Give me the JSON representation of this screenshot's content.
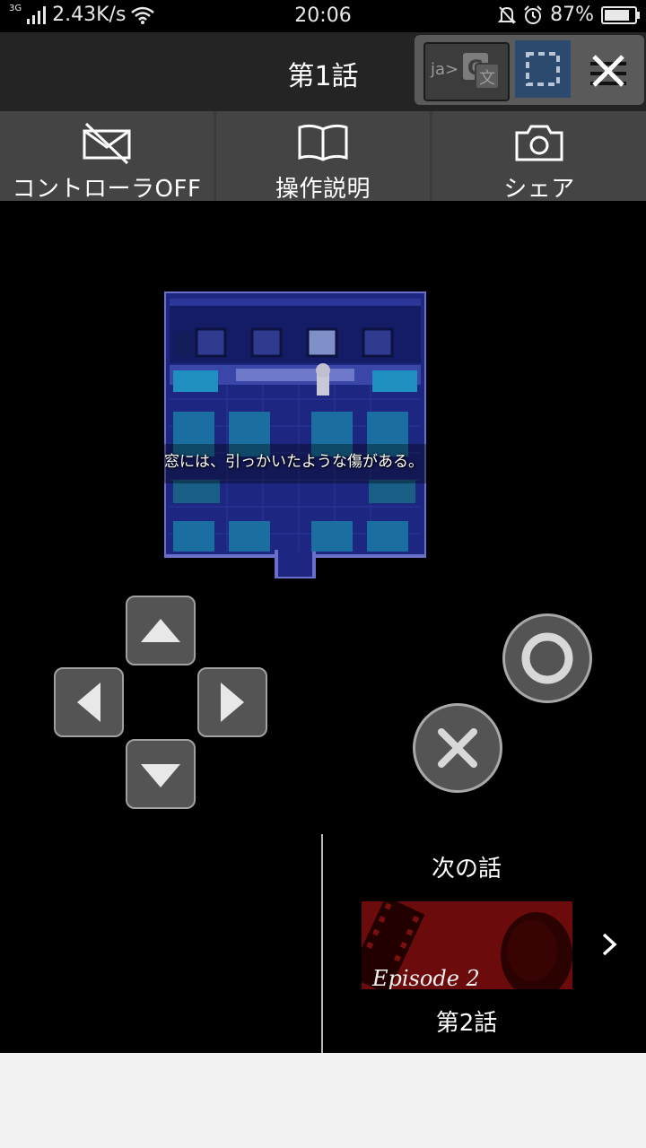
{
  "status_bar": {
    "network_type": "3G",
    "speed": "2.43K/s",
    "time": "20:06",
    "battery": "87%",
    "battery_level": 0.87
  },
  "header": {
    "title": "第1話",
    "translate_label": "ja>"
  },
  "toolbar": {
    "controller_label": "コントローラOFF",
    "help_label": "操作説明",
    "share_label": "シェア"
  },
  "game": {
    "dialog_text": "窓には、引っかいたような傷がある。"
  },
  "next_episode": {
    "heading": "次の話",
    "thumbnail_text": "Episode 2",
    "episode_label": "第2話"
  },
  "colors": {
    "title_bar": "#242424",
    "toolbar": "#444444",
    "select_tool": "#2b4a6d",
    "game_floor": "#1e2a8a",
    "bottom_area": "#f2f2f2"
  }
}
